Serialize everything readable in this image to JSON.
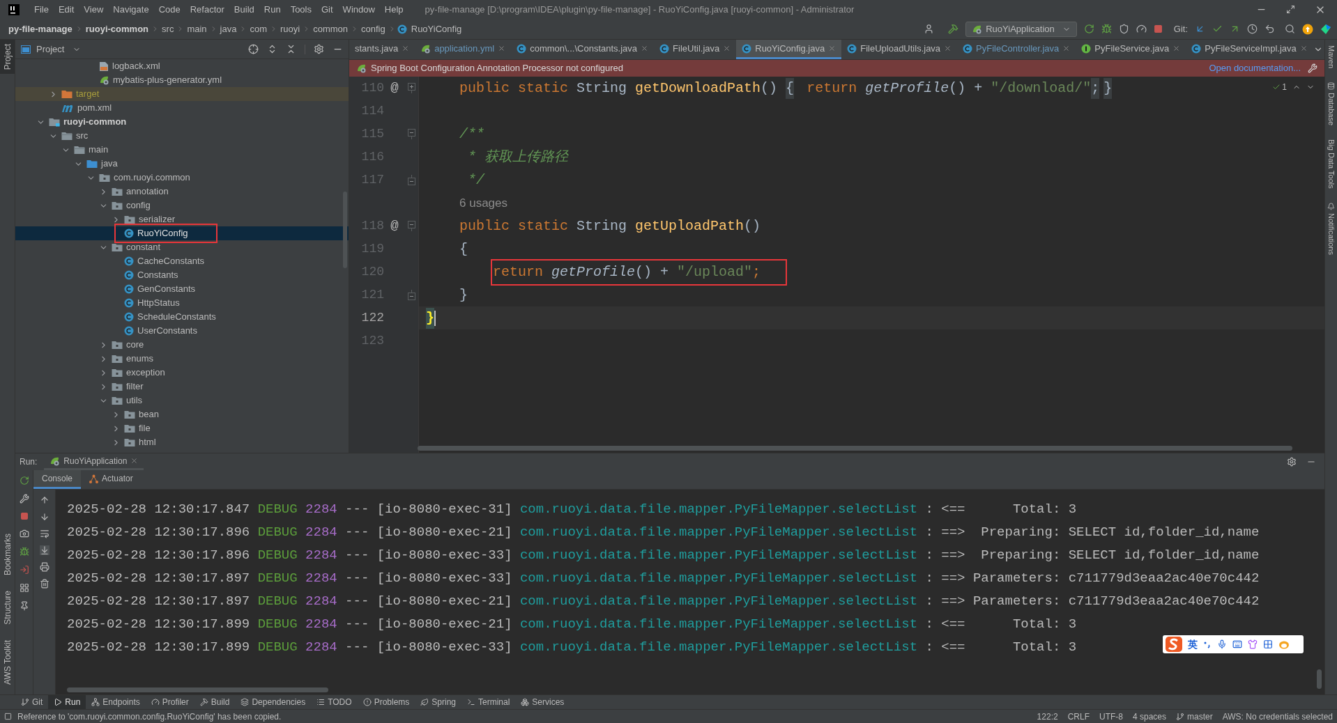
{
  "menu_bar": {
    "items": [
      "File",
      "Edit",
      "View",
      "Navigate",
      "Code",
      "Refactor",
      "Build",
      "Run",
      "Tools",
      "Git",
      "Window",
      "Help"
    ],
    "title": "py-file-manage [D:\\program\\IDEA\\plugin\\py-file-manage] - RuoYiConfig.java [ruoyi-common] - Administrator"
  },
  "breadcrumbs": [
    {
      "label": "py-file-manage",
      "bold": true
    },
    {
      "label": "ruoyi-common",
      "bold": true
    },
    {
      "label": "src",
      "bold": false
    },
    {
      "label": "main",
      "bold": false
    },
    {
      "label": "java",
      "bold": false
    },
    {
      "label": "com",
      "bold": false
    },
    {
      "label": "ruoyi",
      "bold": false
    },
    {
      "label": "common",
      "bold": false
    },
    {
      "label": "config",
      "bold": false
    },
    {
      "label": "RuoYiConfig",
      "bold": false
    }
  ],
  "toolbar": {
    "run_configuration": "RuoYiApplication",
    "vcs_label": "Git:"
  },
  "left_strip": {
    "top": [
      {
        "label": "Project",
        "selected": true
      }
    ],
    "bottom": [
      "Bookmarks",
      "Structure",
      "AWS Toolkit"
    ]
  },
  "right_strip": [
    "Maven",
    "Database",
    "Big Data Tools",
    "Notifications"
  ],
  "project_panel": {
    "title": "Project",
    "tree_above": [
      {
        "label": "logback.xml",
        "kind": "xml",
        "selected": false
      },
      {
        "label": "mybatis-plus-generator.yml",
        "kind": "yml",
        "selected": false
      }
    ],
    "module_tail": [
      {
        "label": "target",
        "kind": "excluded-folder",
        "expanded": false,
        "selected": false
      },
      {
        "label": "pom.xml",
        "kind": "maven",
        "selected": false
      }
    ],
    "tree": [
      {
        "label": "ruoyi-common",
        "kind": "module",
        "expanded": true,
        "selected": false,
        "children": [
          {
            "label": "src",
            "kind": "folder",
            "expanded": true,
            "selected": false,
            "children": [
              {
                "label": "main",
                "kind": "folder",
                "expanded": true,
                "selected": false,
                "children": [
                  {
                    "label": "java",
                    "kind": "source-folder",
                    "expanded": true,
                    "selected": false,
                    "children": [
                      {
                        "label": "com.ruoyi.common",
                        "kind": "package",
                        "expanded": true,
                        "selected": false,
                        "children": [
                          {
                            "label": "annotation",
                            "kind": "package",
                            "expanded": false,
                            "selected": false
                          },
                          {
                            "label": "config",
                            "kind": "package",
                            "expanded": true,
                            "selected": false,
                            "children": [
                              {
                                "label": "serializer",
                                "kind": "package",
                                "expanded": false,
                                "selected": false
                              },
                              {
                                "label": "RuoYiConfig",
                                "kind": "class",
                                "selected": true,
                                "annotated": true
                              }
                            ]
                          },
                          {
                            "label": "constant",
                            "kind": "package",
                            "expanded": true,
                            "selected": false,
                            "children": [
                              {
                                "label": "CacheConstants",
                                "kind": "class",
                                "selected": false
                              },
                              {
                                "label": "Constants",
                                "kind": "class",
                                "selected": false
                              },
                              {
                                "label": "GenConstants",
                                "kind": "class",
                                "selected": false
                              },
                              {
                                "label": "HttpStatus",
                                "kind": "class",
                                "selected": false
                              },
                              {
                                "label": "ScheduleConstants",
                                "kind": "class",
                                "selected": false
                              },
                              {
                                "label": "UserConstants",
                                "kind": "class",
                                "selected": false
                              }
                            ]
                          },
                          {
                            "label": "core",
                            "kind": "package",
                            "expanded": false,
                            "selected": false
                          },
                          {
                            "label": "enums",
                            "kind": "package",
                            "expanded": false,
                            "selected": false
                          },
                          {
                            "label": "exception",
                            "kind": "package",
                            "expanded": false,
                            "selected": false
                          },
                          {
                            "label": "filter",
                            "kind": "package",
                            "expanded": false,
                            "selected": false
                          },
                          {
                            "label": "utils",
                            "kind": "package",
                            "expanded": true,
                            "selected": false,
                            "children": [
                              {
                                "label": "bean",
                                "kind": "package",
                                "expanded": false,
                                "selected": false
                              },
                              {
                                "label": "file",
                                "kind": "package",
                                "expanded": false,
                                "selected": false
                              },
                              {
                                "label": "html",
                                "kind": "package",
                                "expanded": false,
                                "selected": false
                              }
                            ]
                          }
                        ]
                      }
                    ]
                  }
                ]
              }
            ]
          }
        ]
      }
    ]
  },
  "editor": {
    "tabs": [
      {
        "label": "stants.java",
        "kind": "partial",
        "modified": false,
        "selected": false
      },
      {
        "label": "application.yml",
        "kind": "spring",
        "modified": true,
        "selected": false
      },
      {
        "label": "common\\...\\Constants.java",
        "kind": "class",
        "modified": false,
        "selected": false
      },
      {
        "label": "FileUtil.java",
        "kind": "class",
        "modified": false,
        "selected": false
      },
      {
        "label": "RuoYiConfig.java",
        "kind": "class",
        "modified": false,
        "selected": true
      },
      {
        "label": "FileUploadUtils.java",
        "kind": "class",
        "modified": false,
        "selected": false
      },
      {
        "label": "PyFileController.java",
        "kind": "class",
        "modified": true,
        "selected": false
      },
      {
        "label": "PyFileService.java",
        "kind": "interface",
        "modified": false,
        "selected": false
      },
      {
        "label": "PyFileServiceImpl.java",
        "kind": "class",
        "modified": false,
        "selected": false
      }
    ],
    "banner": {
      "message": "Spring Boot Configuration Annotation Processor not configured",
      "link": "Open documentation..."
    },
    "inspection_count": "1",
    "lines": [
      {
        "kind": "code",
        "number": "110",
        "marker": "@",
        "fold_marker": {
          "kind": "start",
          "expanded": false
        },
        "current": false,
        "tokens": [
          {
            "kind": "keyword",
            "text": "    public static "
          },
          {
            "kind": "type",
            "text": "String "
          },
          {
            "kind": "method",
            "text": "getDownloadPath"
          },
          {
            "kind": "plain",
            "text": "() "
          },
          {
            "kind": "fold",
            "text": "{"
          },
          {
            "kind": "keyword",
            "text": " return "
          },
          {
            "kind": "call",
            "text": "getProfile"
          },
          {
            "kind": "plain",
            "text": "() + "
          },
          {
            "kind": "string",
            "text": "\"/download/\""
          },
          {
            "kind": "fold",
            "text": ";"
          },
          {
            "kind": "fold",
            "text": "}"
          }
        ]
      },
      {
        "kind": "code",
        "number": "114"
      },
      {
        "kind": "code",
        "number": "115",
        "fold_marker": {
          "kind": "start",
          "expanded": true
        },
        "current": false,
        "tokens": [
          {
            "kind": "comment",
            "text": "    /**"
          }
        ]
      },
      {
        "kind": "code",
        "number": "116",
        "current": false,
        "tokens": [
          {
            "kind": "comment",
            "text": "     * 获取上传路径"
          }
        ]
      },
      {
        "kind": "code",
        "number": "117",
        "fold_marker": {
          "kind": "end",
          "expanded": true
        },
        "current": false,
        "tokens": [
          {
            "kind": "comment",
            "text": "     */"
          }
        ]
      },
      {
        "kind": "hint",
        "text": "6 usages"
      },
      {
        "kind": "code",
        "number": "118",
        "marker": "@",
        "fold_marker": {
          "kind": "start",
          "expanded": true
        },
        "current": false,
        "tokens": [
          {
            "kind": "keyword",
            "text": "    public static "
          },
          {
            "kind": "type",
            "text": "String "
          },
          {
            "kind": "method",
            "text": "getUploadPath"
          },
          {
            "kind": "plain",
            "text": "()"
          }
        ]
      },
      {
        "kind": "code",
        "number": "119",
        "current": false,
        "tokens": [
          {
            "kind": "plain",
            "text": "    {"
          }
        ]
      },
      {
        "kind": "code",
        "number": "120",
        "current": false,
        "annotated": true,
        "tokens": [
          {
            "kind": "keyword",
            "text": "        return "
          },
          {
            "kind": "call",
            "text": "getProfile"
          },
          {
            "kind": "plain",
            "text": "() + "
          },
          {
            "kind": "string",
            "text": "\"/upload\""
          },
          {
            "kind": "keyword",
            "text": ";"
          }
        ]
      },
      {
        "kind": "code",
        "number": "121",
        "fold_marker": {
          "kind": "end",
          "expanded": true
        },
        "current": false,
        "tokens": [
          {
            "kind": "plain",
            "text": "    }"
          }
        ]
      },
      {
        "kind": "code",
        "number": "122",
        "current": true,
        "tokens": [
          {
            "kind": "brace-match",
            "text": "}"
          }
        ]
      },
      {
        "kind": "code",
        "number": "123"
      }
    ]
  },
  "run_panel": {
    "label": "Run:",
    "tab": "RuoYiApplication",
    "subtabs": [
      {
        "label": "Console",
        "selected": true
      },
      {
        "label": "Actuator",
        "selected": false
      }
    ],
    "log": [
      {
        "time": "2025-02-28 12:30:17.847",
        "level": "DEBUG",
        "pid": "2284",
        "sep": "---",
        "thread": "[io-8080-exec-31]",
        "logger": "com.ruoyi.data.file.mapper.PyFileMapper.selectList",
        "colon": ":",
        "arrow": "<==",
        "label": "Total:",
        "value": "3"
      },
      {
        "time": "2025-02-28 12:30:17.896",
        "level": "DEBUG",
        "pid": "2284",
        "sep": "---",
        "thread": "[io-8080-exec-21]",
        "logger": "com.ruoyi.data.file.mapper.PyFileMapper.selectList",
        "colon": ":",
        "arrow": "==>",
        "label": "Preparing:",
        "value": "SELECT id,folder_id,name"
      },
      {
        "time": "2025-02-28 12:30:17.896",
        "level": "DEBUG",
        "pid": "2284",
        "sep": "---",
        "thread": "[io-8080-exec-33]",
        "logger": "com.ruoyi.data.file.mapper.PyFileMapper.selectList",
        "colon": ":",
        "arrow": "==>",
        "label": "Preparing:",
        "value": "SELECT id,folder_id,name"
      },
      {
        "time": "2025-02-28 12:30:17.897",
        "level": "DEBUG",
        "pid": "2284",
        "sep": "---",
        "thread": "[io-8080-exec-33]",
        "logger": "com.ruoyi.data.file.mapper.PyFileMapper.selectList",
        "colon": ":",
        "arrow": "==>",
        "label": "Parameters:",
        "value": "c711779d3eaa2ac40e70c442"
      },
      {
        "time": "2025-02-28 12:30:17.897",
        "level": "DEBUG",
        "pid": "2284",
        "sep": "---",
        "thread": "[io-8080-exec-21]",
        "logger": "com.ruoyi.data.file.mapper.PyFileMapper.selectList",
        "colon": ":",
        "arrow": "==>",
        "label": "Parameters:",
        "value": "c711779d3eaa2ac40e70c442"
      },
      {
        "time": "2025-02-28 12:30:17.899",
        "level": "DEBUG",
        "pid": "2284",
        "sep": "---",
        "thread": "[io-8080-exec-21]",
        "logger": "com.ruoyi.data.file.mapper.PyFileMapper.selectList",
        "colon": ":",
        "arrow": "<==",
        "label": "Total:",
        "value": "3"
      },
      {
        "time": "2025-02-28 12:30:17.899",
        "level": "DEBUG",
        "pid": "2284",
        "sep": "---",
        "thread": "[io-8080-exec-33]",
        "logger": "com.ruoyi.data.file.mapper.PyFileMapper.selectList",
        "colon": ":",
        "arrow": "<==",
        "label": "Total:",
        "value": "3"
      }
    ]
  },
  "ime_toolbar": {
    "mode": "英"
  },
  "tool_windows": [
    {
      "label": "Git",
      "selected": false
    },
    {
      "label": "Run",
      "selected": true
    },
    {
      "label": "Endpoints",
      "selected": false
    },
    {
      "label": "Profiler",
      "selected": false
    },
    {
      "label": "Build",
      "selected": false
    },
    {
      "label": "Dependencies",
      "selected": false
    },
    {
      "label": "TODO",
      "selected": false
    },
    {
      "label": "Problems",
      "selected": false
    },
    {
      "label": "Spring",
      "selected": false
    },
    {
      "label": "Terminal",
      "selected": false
    },
    {
      "label": "Services",
      "selected": false
    }
  ],
  "status_bar": {
    "message": "Reference to 'com.ruoyi.common.config.RuoYiConfig' has been copied.",
    "position": "122:2",
    "line_separator": "CRLF",
    "encoding": "UTF-8",
    "indent": "4 spaces",
    "branch": "master",
    "aws": "AWS: No credentials selected"
  }
}
